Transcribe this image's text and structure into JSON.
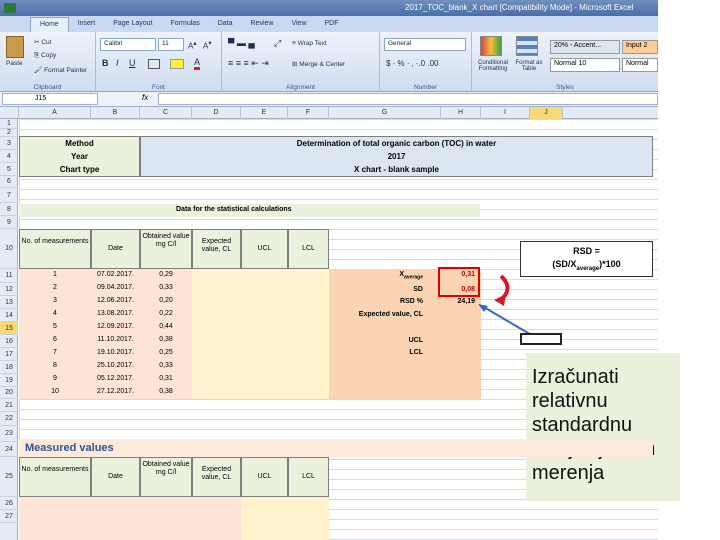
{
  "window": {
    "title": "2017_TOC_blank_X chart [Compatibility Mode] - Microsoft Excel"
  },
  "tabs": [
    "Home",
    "Insert",
    "Page Layout",
    "Formulas",
    "Data",
    "Review",
    "View",
    "PDF"
  ],
  "ribbon": {
    "clipboard": {
      "label": "Clipboard",
      "paste": "Paste",
      "cut": "Cut",
      "copy": "Copy",
      "format_painter": "Format Painter"
    },
    "font": {
      "label": "Font",
      "name": "Calibri",
      "size": "11"
    },
    "alignment": {
      "label": "Alignment",
      "wrap": "Wrap Text",
      "merge": "Merge & Center"
    },
    "number": {
      "label": "Number",
      "format": "General"
    },
    "styles": {
      "label": "Styles",
      "conditional": "Conditional Formatting",
      "format_table": "Format as Table",
      "cell_styles": [
        "20% - Accent...",
        "Input 2",
        "Normal 10",
        "Normal"
      ]
    }
  },
  "formula_bar": {
    "name_box": "J15",
    "fx": "fx"
  },
  "columns": [
    "A",
    "B",
    "C",
    "D",
    "E",
    "F",
    "G",
    "H",
    "I",
    "J"
  ],
  "rows": [
    "1",
    "2",
    "3",
    "4",
    "5",
    "6",
    "7",
    "8",
    "9",
    "10",
    "11",
    "12",
    "13",
    "14",
    "15",
    "16",
    "17",
    "18",
    "19",
    "20",
    "21",
    "22",
    "23",
    "24",
    "25",
    "26",
    "27"
  ],
  "header": {
    "method_label": "Method",
    "method_value": "Determination of total organic carbon (TOC) in water",
    "year_label": "Year",
    "year_value": "2017",
    "chart_label": "Chart type",
    "chart_value": "X chart - blank sample"
  },
  "stats_title": "Data for the statistical calculations",
  "table_headers": {
    "no": "No. of measurements",
    "date": "Date",
    "obtained": "Obtained value mg C/l",
    "expected": "Expected value, CL",
    "ucl": "UCL",
    "lcl": "LCL"
  },
  "table_rows": [
    {
      "no": "1",
      "date": "07.02.2017.",
      "val": "0,29"
    },
    {
      "no": "2",
      "date": "09.04.2017.",
      "val": "0,33"
    },
    {
      "no": "3",
      "date": "12.06.2017.",
      "val": "0,20"
    },
    {
      "no": "4",
      "date": "13.08.2017.",
      "val": "0,22"
    },
    {
      "no": "5",
      "date": "12.09.2017.",
      "val": "0,44"
    },
    {
      "no": "6",
      "date": "11.10.2017.",
      "val": "0,38"
    },
    {
      "no": "7",
      "date": "19.10.2017.",
      "val": "0,25"
    },
    {
      "no": "8",
      "date": "25.10.2017.",
      "val": "0,33"
    },
    {
      "no": "9",
      "date": "05.12.2017.",
      "val": "0,31"
    },
    {
      "no": "10",
      "date": "27.12.2017.",
      "val": "0,38"
    }
  ],
  "stats": {
    "xavg_label": "X",
    "xavg_sub": "average",
    "xavg_val": "0,31",
    "sd_label": "SD",
    "sd_val": "0,08",
    "rsd_label": "RSD %",
    "rsd_val": "24,19",
    "cl_label": "Expected value, CL",
    "ucl_label": "UCL",
    "lcl_label": "LCL"
  },
  "rsd_box": {
    "line1": "RSD =",
    "line2_a": "(SD/X",
    "line2_sub": "average",
    "line2_b": ")*100"
  },
  "callout": "Izračunati relativnu standardnu devijaciju svih merenja",
  "measured_title": "Measured values"
}
